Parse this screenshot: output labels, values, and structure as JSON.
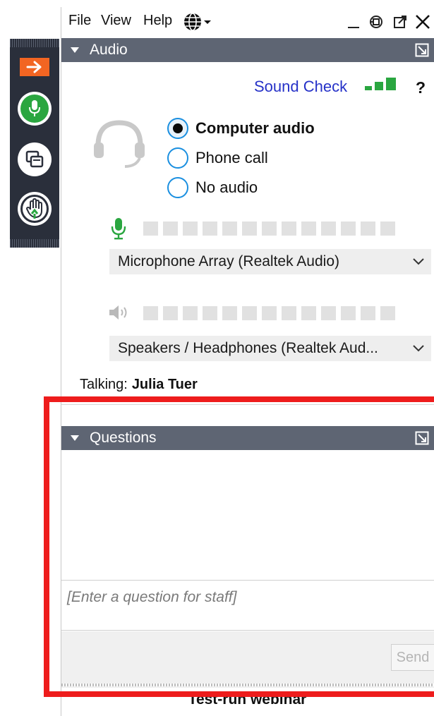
{
  "menu": {
    "file": "File",
    "view": "View",
    "help": "Help",
    "language_icon": "globe-icon"
  },
  "window_controls": {
    "minimize": "minimize-icon",
    "pin": "pin-icon",
    "popout": "popout-icon",
    "close": "close-icon"
  },
  "rail": {
    "items": [
      "collapse-arrow-icon",
      "microphone-icon",
      "screen-share-icon",
      "raise-hand-icon"
    ],
    "accent": "#f26522",
    "mic_color": "#2aa640"
  },
  "audio": {
    "title": "Audio",
    "sound_check": "Sound Check",
    "help": "?",
    "signal_level": 3,
    "options": [
      {
        "label": "Computer audio",
        "selected": true
      },
      {
        "label": "Phone call",
        "selected": false
      },
      {
        "label": "No audio",
        "selected": false
      }
    ],
    "microphone": {
      "selected": "Microphone Array (Realtek Audio)",
      "level": 0
    },
    "speaker": {
      "selected": "Speakers / Headphones (Realtek Aud...",
      "level": 0
    },
    "talking_label": "Talking:",
    "talking_name": "Julia Tuer"
  },
  "questions": {
    "title": "Questions",
    "input_placeholder": "[Enter a question for staff]",
    "send_label": "Send"
  },
  "footer": {
    "webinar_title": "Test-run webinar"
  },
  "colors": {
    "header_bg": "#5e6573",
    "link": "#2632c8",
    "radio_border": "#1a8fe0",
    "highlight": "#ee1c1c"
  }
}
